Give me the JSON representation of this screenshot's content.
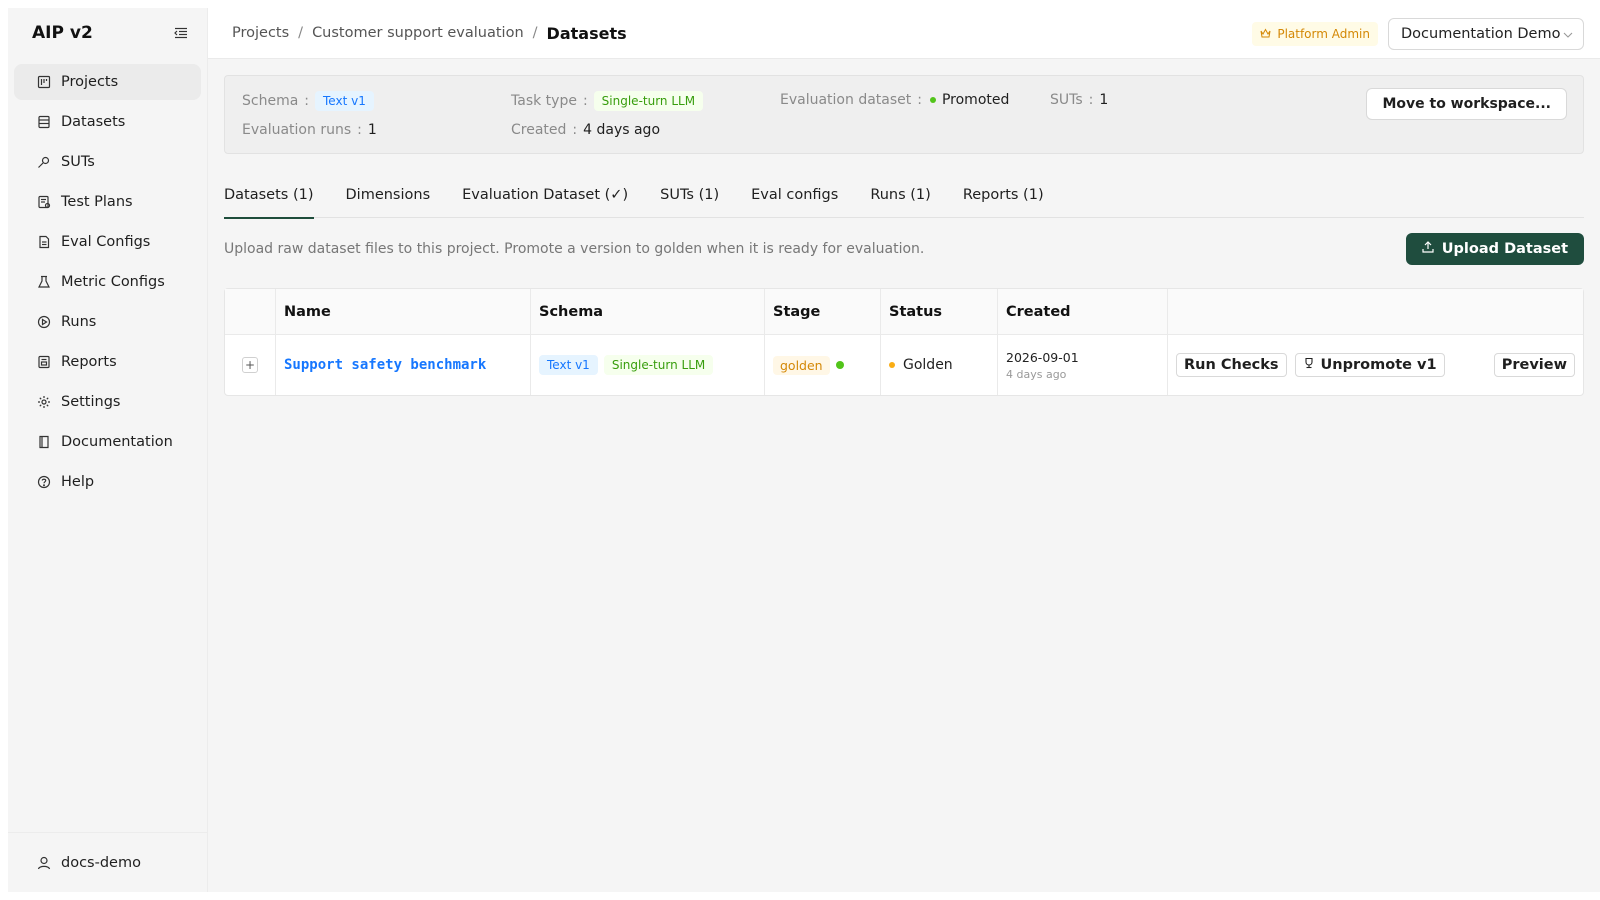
{
  "app": {
    "title": "AIP v2"
  },
  "sidebar": {
    "items": [
      {
        "label": "Projects",
        "icon": "projects-icon",
        "active": true
      },
      {
        "label": "Datasets",
        "icon": "datasets-icon"
      },
      {
        "label": "SUTs",
        "icon": "suts-icon"
      },
      {
        "label": "Test Plans",
        "icon": "test-plans-icon"
      },
      {
        "label": "Eval Configs",
        "icon": "eval-configs-icon"
      },
      {
        "label": "Metric Configs",
        "icon": "metric-configs-icon"
      },
      {
        "label": "Runs",
        "icon": "runs-icon"
      },
      {
        "label": "Reports",
        "icon": "reports-icon"
      },
      {
        "label": "Settings",
        "icon": "gear-icon"
      },
      {
        "label": "Documentation",
        "icon": "book-icon"
      },
      {
        "label": "Help",
        "icon": "help-icon"
      }
    ],
    "user": "docs-demo"
  },
  "header": {
    "breadcrumb": [
      "Projects",
      "Customer support evaluation",
      "Datasets"
    ],
    "admin_badge": "Platform Admin",
    "workspace": "Documentation Demo"
  },
  "summary": {
    "schema_label": "Schema",
    "schema_value": "Text v1",
    "task_type_label": "Task type",
    "task_type_value": "Single-turn LLM",
    "eval_dataset_label": "Evaluation dataset",
    "eval_dataset_value": "Promoted",
    "suts_label": "SUTs",
    "suts_value": "1",
    "runs_label": "Evaluation runs",
    "runs_value": "1",
    "created_label": "Created",
    "created_value": "4 days ago",
    "move_button": "Move to workspace..."
  },
  "tabs": [
    {
      "label": "Datasets (1)",
      "active": true
    },
    {
      "label": "Dimensions"
    },
    {
      "label": "Evaluation Dataset (✓)"
    },
    {
      "label": "SUTs (1)"
    },
    {
      "label": "Eval configs"
    },
    {
      "label": "Runs (1)"
    },
    {
      "label": "Reports (1)"
    }
  ],
  "toolbar": {
    "description": "Upload raw dataset files to this project. Promote a version to golden when it is ready for evaluation.",
    "upload_label": "Upload Dataset"
  },
  "table": {
    "columns": [
      "",
      "Name",
      "Schema",
      "Stage",
      "Status",
      "Created",
      ""
    ],
    "rows": [
      {
        "name": "Support safety benchmark",
        "schema_tags": [
          "Text v1",
          "Single-turn LLM"
        ],
        "stage": "golden",
        "status": "Golden",
        "created_date": "2026-09-01",
        "created_relative": "4 days ago",
        "actions": {
          "run_checks": "Run Checks",
          "unpromote": "Unpromote v1",
          "preview": "Preview"
        }
      }
    ]
  },
  "colors": {
    "accent": "#1f4d3e",
    "link": "#1677ff",
    "golden": "#d48806",
    "status_green": "#52c41a",
    "status_orange": "#faad14"
  }
}
